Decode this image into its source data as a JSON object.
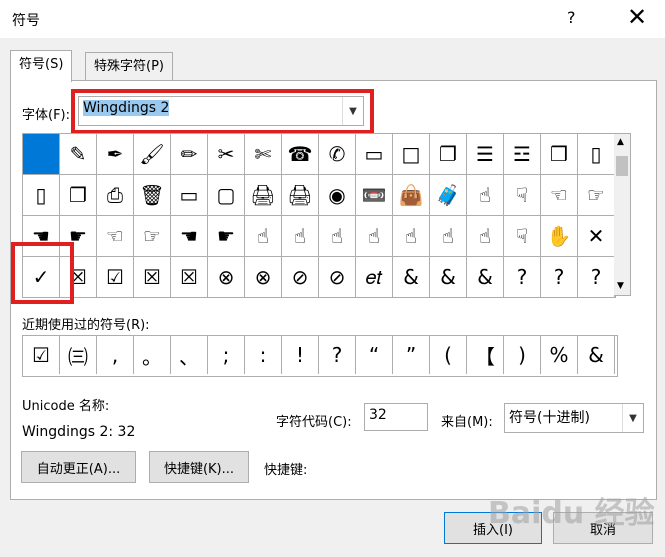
{
  "window": {
    "title": "符号",
    "help_icon": "?",
    "close_icon": "✕"
  },
  "tabs": [
    {
      "label": "符号(S)"
    },
    {
      "label": "特殊字符(P)"
    }
  ],
  "font": {
    "label": "字体(F):",
    "value": "Wingdings 2"
  },
  "symbols": [
    [
      "",
      "✎",
      "✒",
      "🖌",
      "✏",
      "✂",
      "✄",
      "☎",
      "✆",
      "▭",
      "□",
      "❐",
      "☰",
      "☲",
      "❒",
      "▯"
    ],
    [
      "▯",
      "❐",
      "⎙",
      "🗑",
      "▭",
      "▢",
      "🖨",
      "🖨",
      "◉",
      "📼",
      "👜",
      "🧳",
      "☝",
      "☟",
      "☜",
      "☞"
    ],
    [
      "☚",
      "☛",
      "☜",
      "☞",
      "☚",
      "☛",
      "☝",
      "☝",
      "☝",
      "☝",
      "☝",
      "☝",
      "☝",
      "☟",
      "✋",
      "✕"
    ],
    [
      "✓",
      "☒",
      "☑",
      "☒",
      "☒",
      "⊗",
      "⊗",
      "⊘",
      "⊘",
      "𝑒𝑡",
      "&",
      "&",
      "&",
      "?",
      "?",
      "?"
    ]
  ],
  "recent": {
    "label": "近期使用过的符号(R):",
    "items": [
      "☑",
      "㈢",
      ",",
      "。",
      "、",
      ";",
      ":",
      "!",
      "?",
      "“",
      "”",
      "(",
      "【",
      ")",
      "%",
      "&"
    ]
  },
  "unicode": {
    "label": "Unicode 名称:",
    "name": "Wingdings 2: 32"
  },
  "charcode": {
    "label": "字符代码(C):",
    "value": "32"
  },
  "from": {
    "label": "来自(M):",
    "value": "符号(十进制)"
  },
  "buttons": {
    "autocorrect": "自动更正(A)...",
    "shortcut": "快捷键(K)...",
    "shortcut_label": "快捷键:",
    "insert": "插入(I)",
    "cancel": "取消"
  },
  "watermark": "Baidu 经验"
}
